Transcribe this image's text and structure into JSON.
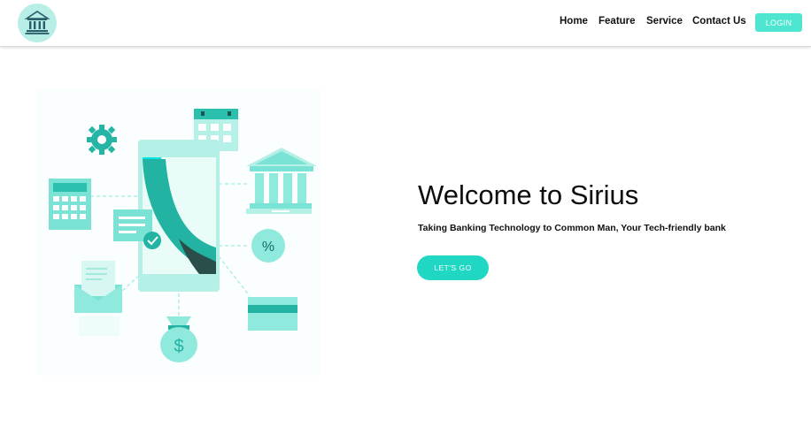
{
  "brand": {
    "logo_icon": "bank-building-icon"
  },
  "nav": {
    "items": [
      {
        "label": "Home"
      },
      {
        "label": "Feature"
      },
      {
        "label": "Service"
      },
      {
        "label": "Contact Us"
      }
    ],
    "login_label": "LOGIN"
  },
  "hero": {
    "title": "Welcome to Sirius",
    "subtitle": "Taking Banking Technology to Common Man, Your Tech-friendly bank",
    "cta_label": "LET'S GO",
    "illustration_percent_label": "%",
    "illustration_dollar_label": "$"
  },
  "colors": {
    "accent": "#1fd7c2",
    "light_accent": "#8ff0e1",
    "dark_teal": "#2a4e4a"
  }
}
